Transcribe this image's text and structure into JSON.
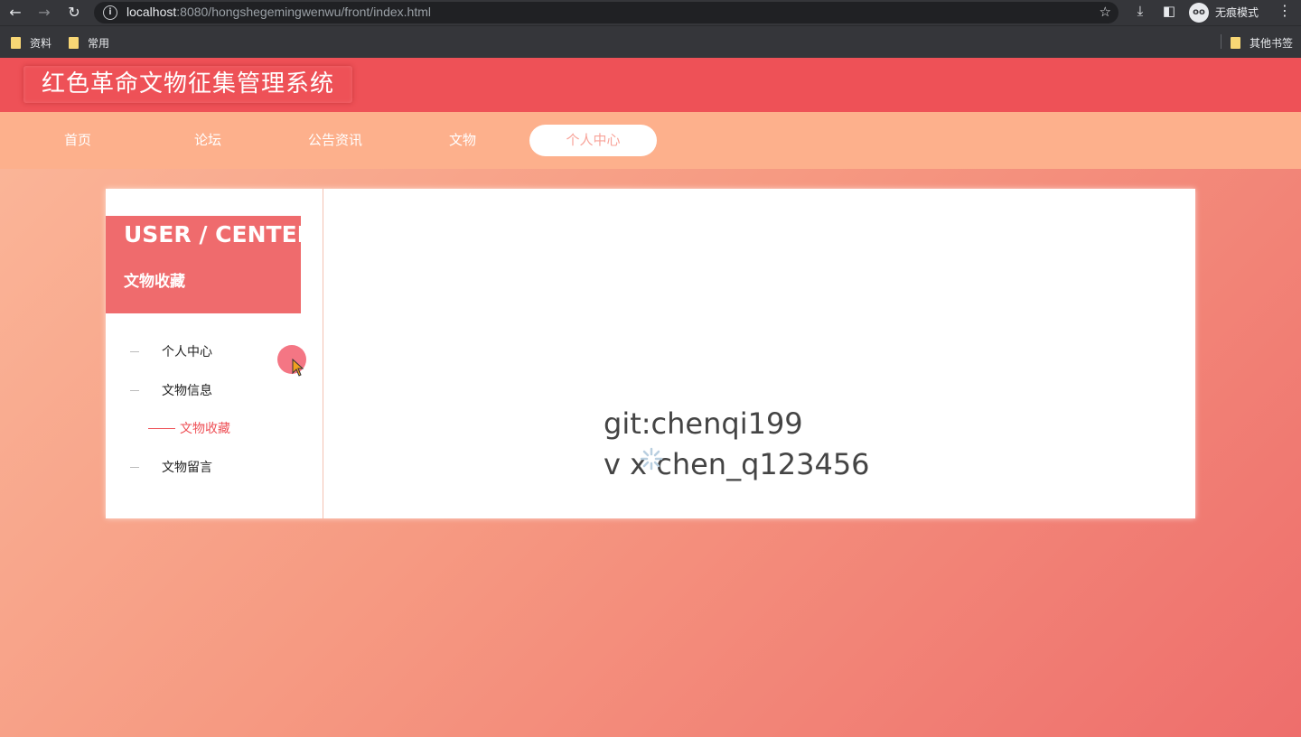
{
  "browser": {
    "url_host": "localhost",
    "url_rest": ":8080/hongshegemingwenwu/front/index.html",
    "incognito_label": "无痕模式",
    "bookmarks": [
      "资料",
      "常用"
    ],
    "other_bookmarks": "其他书签",
    "icons": [
      "back-icon",
      "forward-icon",
      "reload-icon",
      "info-icon",
      "star-icon",
      "download-icon",
      "sidepanel-icon",
      "incognito-icon",
      "menu-icon"
    ]
  },
  "site": {
    "title": "红色革命文物征集管理系统",
    "nav": [
      {
        "label": "首页"
      },
      {
        "label": "论坛"
      },
      {
        "label": "公告资讯"
      },
      {
        "label": "文物"
      },
      {
        "label": "个人中心",
        "active": true
      }
    ]
  },
  "sidebar": {
    "heading_en": "USER / CENTER",
    "heading_cn": "文物收藏",
    "items": [
      {
        "label": "个人中心"
      },
      {
        "label": "文物信息"
      },
      {
        "label": "文物收藏",
        "active": true
      },
      {
        "label": "文物留言"
      }
    ]
  },
  "content": {
    "watermark_line1": "git:chenqi199",
    "watermark_line2": "v x chen_q123456"
  },
  "colors": {
    "header": "#ee5157",
    "nav_bar": "#fdb08c",
    "side_head": "#ef6b6d",
    "accent": "#ee5157"
  }
}
